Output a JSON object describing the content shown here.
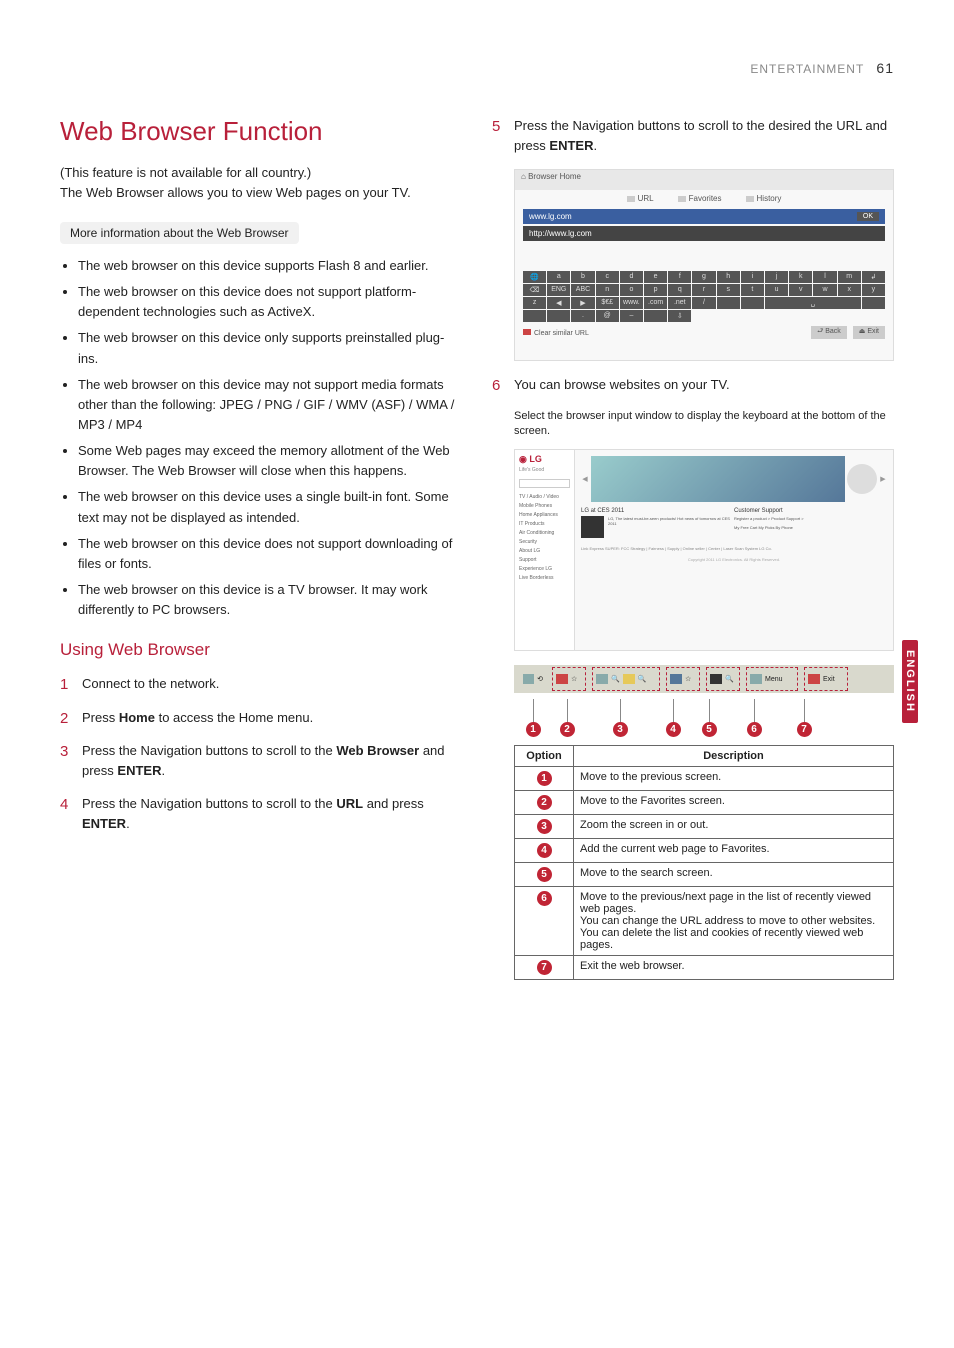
{
  "header": {
    "section": "ENTERTAINMENT",
    "page_number": "61"
  },
  "side_tab": "ENGLISH",
  "title": "Web Browser Function",
  "intro": "(This feature is not available for all country.)\nThe Web Browser allows you to view Web pages on your TV.",
  "infobox_title": "More information about the Web Browser",
  "bullets": [
    "The web browser on this device supports Flash 8 and earlier.",
    "The web browser on this device does not support platform-dependent technologies such as ActiveX.",
    "The web browser on this device only supports preinstalled plug-ins.",
    "The web browser on this device may not support media formats other than the following: JPEG / PNG / GIF / WMV (ASF) / WMA / MP3 / MP4",
    "Some Web pages may exceed the memory allotment of the Web Browser. The Web Browser will close when this happens.",
    "The web browser on this device uses a single built-in font. Some text may not be displayed as intended.",
    "The web browser on this device does not support downloading of files or fonts.",
    "The web browser on this device is a TV browser. It may work differently to PC browsers."
  ],
  "subheading": "Using Web Browser",
  "steps_left": [
    {
      "text": "Connect to the network."
    },
    {
      "pre": "Press ",
      "b1": "Home",
      "post": " to access the Home menu."
    },
    {
      "pre": "Press the Navigation buttons to scroll to the ",
      "b1": "Web Browser",
      "mid": " and press ",
      "b2": "ENTER",
      "post": "."
    },
    {
      "pre": "Press the Navigation buttons to scroll to the ",
      "b1": "URL",
      "mid": " and press ",
      "b2": "ENTER",
      "post": "."
    }
  ],
  "steps_right": [
    {
      "pre": "Press the Navigation buttons to scroll to the desired the URL and press ",
      "b1": "ENTER",
      "post": "."
    },
    {
      "text": "You can browse websites on your TV.",
      "sub": "Select the browser input window to display the keyboard at the bottom of the screen."
    }
  ],
  "fig1": {
    "title": "Browser Home",
    "tabs": [
      "URL",
      "Favorites",
      "History"
    ],
    "url_input": "www.lg.com",
    "url_display": "http://www.lg.com",
    "ok": "OK",
    "keys_row1": [
      "🌐",
      "a",
      "b",
      "c",
      "d",
      "e",
      "f",
      "g",
      "h",
      "i",
      "j",
      "k",
      "l",
      "m",
      "↲",
      "⌫"
    ],
    "keys_row2": [
      "ENG",
      "ABC",
      "n",
      "o",
      "p",
      "q",
      "r",
      "s",
      "t",
      "u",
      "v",
      "w",
      "x",
      "y",
      "z",
      "◀",
      "▶"
    ],
    "keys_row3": [
      "$€£",
      "www.",
      ".com",
      ".net",
      "/",
      "",
      "",
      "␣",
      "",
      "",
      "",
      ".",
      "@",
      "–",
      "",
      "⇩"
    ],
    "clear": "Clear similar URL",
    "back": "Back",
    "exit": "Exit"
  },
  "fig2": {
    "logo": "LG",
    "tagline": "Life's Good",
    "menu": [
      "TV / Audio / Video",
      "Mobile Phones",
      "Home Appliances",
      "IT Products",
      "Air Conditioning",
      "Security",
      "About LG",
      "Support",
      "Experience LG",
      "Live Borderless"
    ],
    "h1": "LG at CES 2011",
    "h2": "Customer Support",
    "sub1": "LG, The latest must-be-seen products! Hot news of tomorrow at CES 2011",
    "r1": "Register a product >",
    "r2": "Product Support >",
    "foot": "My Free Cart   My Picks   By Phone",
    "foot2": "Link Express   SUPER: FCC Strategy | Fairness | Supply | Online seller | Center | Laser Scan System LG Co.",
    "cr": "Copyright 2011 LG Electronics. All Rights Reserved."
  },
  "toolbar": {
    "items": [
      "back-nav",
      "favorites",
      "zoom-out",
      "zoom-in",
      "add-fav",
      "search",
      "menu",
      "exit"
    ],
    "menu_label": "Menu",
    "exit_label": "Exit"
  },
  "table": {
    "h_option": "Option",
    "h_desc": "Description",
    "rows": [
      {
        "n": "1",
        "d": "Move to the previous screen."
      },
      {
        "n": "2",
        "d": "Move to the Favorites screen."
      },
      {
        "n": "3",
        "d": "Zoom the screen in or out."
      },
      {
        "n": "4",
        "d": "Add the current web page to Favorites."
      },
      {
        "n": "5",
        "d": "Move to the search screen."
      },
      {
        "n": "6",
        "d": "Move to the previous/next page in the list of recently viewed web pages.\nYou can change the URL address to move to other websites.\nYou can delete the list and cookies of recently viewed web pages."
      },
      {
        "n": "7",
        "d": "Exit the web browser."
      }
    ]
  }
}
